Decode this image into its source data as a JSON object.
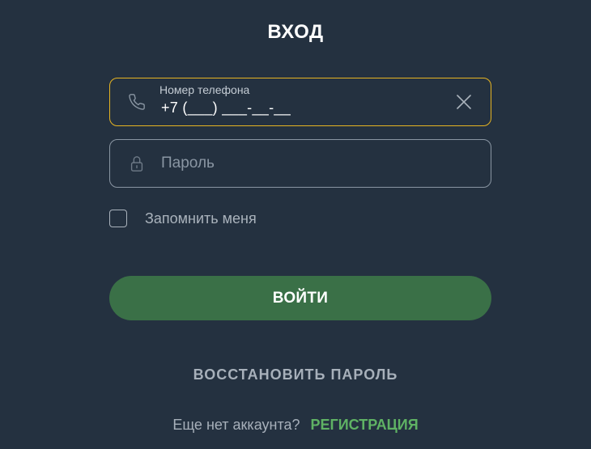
{
  "title": "ВХОД",
  "phone_field": {
    "label": "Номер телефона",
    "value": "+7 (___) ___-__-__"
  },
  "password_field": {
    "placeholder": "Пароль"
  },
  "remember_me": {
    "label": "Запомнить меня",
    "checked": false
  },
  "login_button": {
    "label": "ВОЙТИ"
  },
  "restore_password": {
    "label": "ВОССТАНОВИТЬ ПАРОЛЬ"
  },
  "register": {
    "question": "Еще нет аккаунта?",
    "link": "РЕГИСТРАЦИЯ"
  },
  "colors": {
    "background": "#243140",
    "accent_border": "#e6b422",
    "button": "#3a7047",
    "link": "#5fb264"
  },
  "icons": {
    "phone": "phone-icon",
    "password": "lock-icon",
    "clear": "close-icon"
  }
}
